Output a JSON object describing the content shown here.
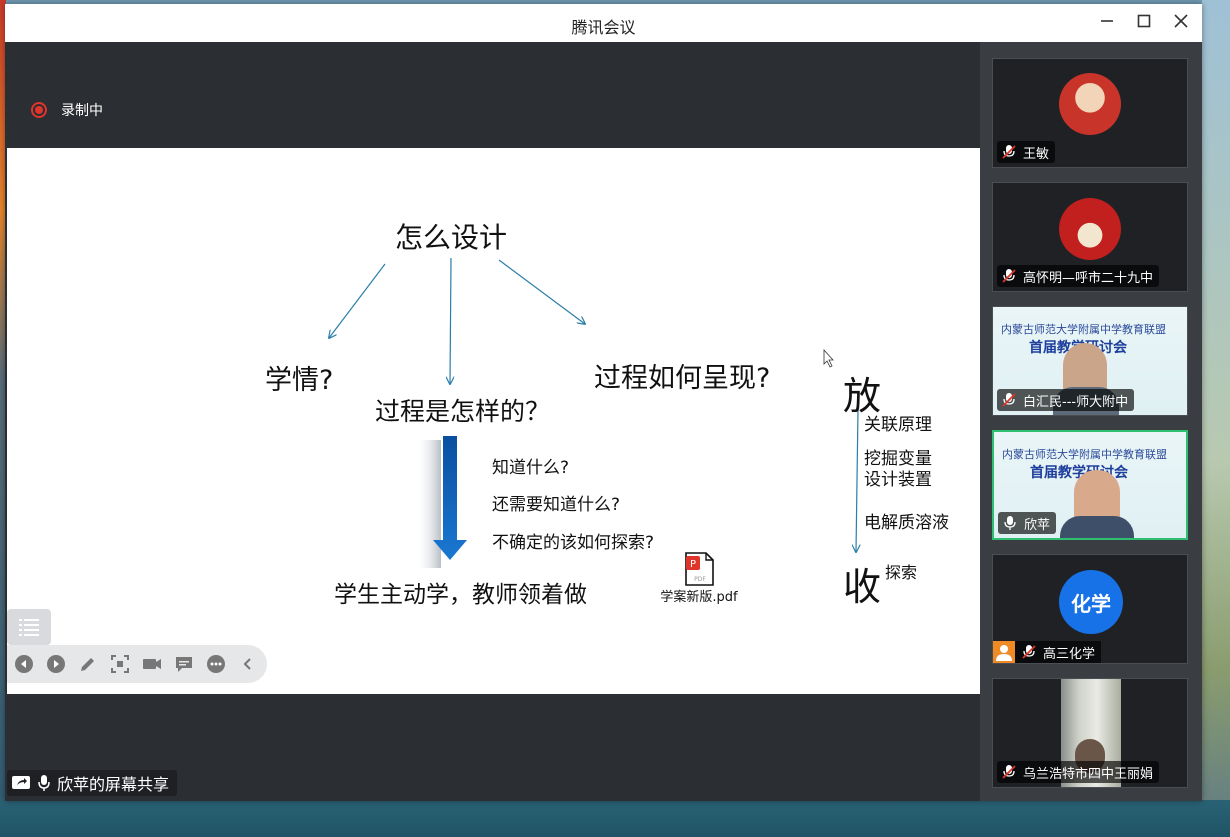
{
  "window": {
    "title": "腾讯会议"
  },
  "recording": {
    "label": "录制中"
  },
  "slide": {
    "heading": "怎么设计",
    "branch_left": "学情?",
    "branch_center": "过程是怎样的？",
    "branch_right": "过程如何呈现?",
    "questions": [
      "知道什么?",
      "还需要知道什么?",
      "不确定的该如何探索?"
    ],
    "conclusion": "学生主动学，教师领着做",
    "fang": "放",
    "shou": "收",
    "side_items": [
      "关联原理",
      "挖掘变量\n设计装置",
      "电解质溶液"
    ],
    "explore": "探索",
    "file": {
      "name": "学案新版.pdf",
      "icon": "pdf-file-icon"
    }
  },
  "share": {
    "label": "欣苹的屏幕共享"
  },
  "participants": [
    {
      "name": "王敏",
      "muted": true
    },
    {
      "name": "高怀明—呼市二十九中",
      "muted": true
    },
    {
      "name": "白汇民---师大附中",
      "muted": true
    },
    {
      "name": "欣苹",
      "muted": false,
      "speaking": true
    },
    {
      "name": "高三化学",
      "muted": true,
      "avatar_text": "化学"
    },
    {
      "name": "乌兰浩特市四中王丽娟",
      "muted": true
    }
  ],
  "banner": {
    "line1": "内蒙古师范大学附属中学教育联盟",
    "line2": "首届教学研讨会"
  },
  "colors": {
    "accent": "#1a73e8",
    "recording": "#e0352b",
    "speaking_border": "#2fbf71"
  }
}
